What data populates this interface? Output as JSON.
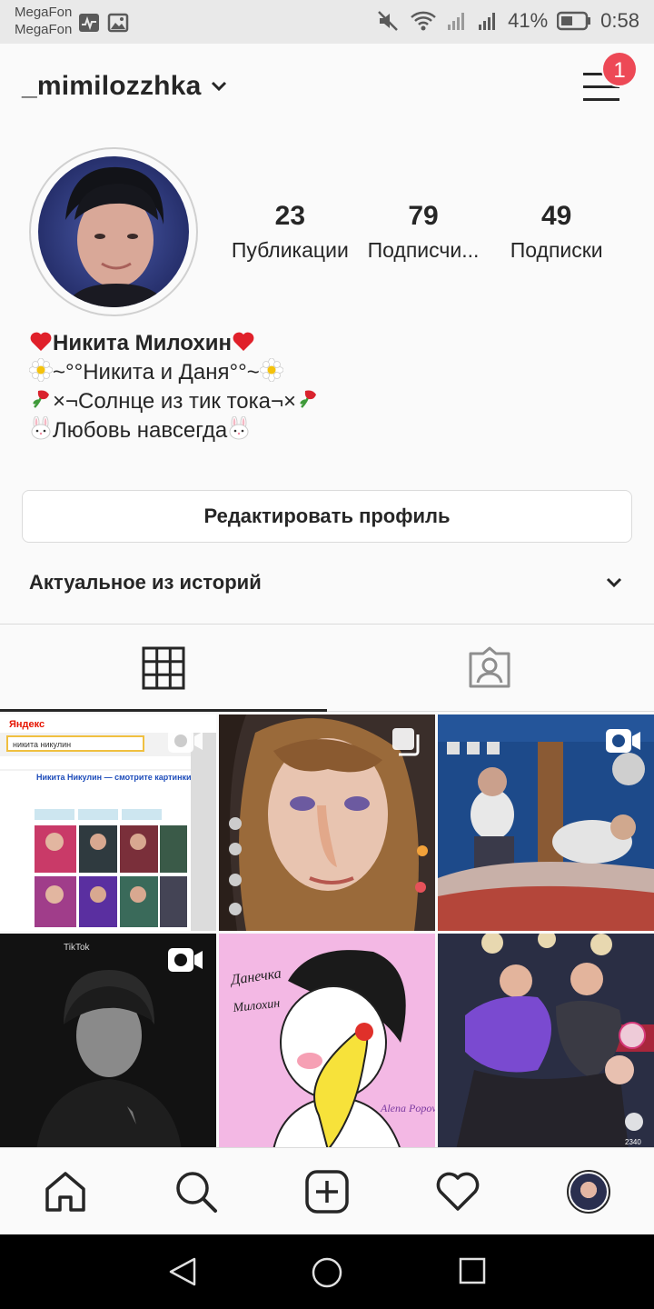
{
  "status_bar": {
    "carrier_1": "MegaFon",
    "carrier_2": "MegaFon",
    "battery": "41%",
    "time": "0:58"
  },
  "header": {
    "username": "_mimilozzhka",
    "notification_count": "1"
  },
  "profile": {
    "stats": [
      {
        "value": "23",
        "label": "Публикации"
      },
      {
        "value": "79",
        "label": "Подписчи..."
      },
      {
        "value": "49",
        "label": "Подписки"
      }
    ],
    "bio": {
      "line1": "Никита Милохин",
      "line2": "~°°Никита и Даня°°~",
      "line3": "×¬Солнце из тик тока¬×",
      "line4": "Любовь навсегда"
    },
    "edit_button": "Редактировать профиль",
    "highlights_label": "Актуальное из историй"
  },
  "grid": {
    "posts": [
      {
        "type": "video",
        "title": "Яндекс search screenshot"
      },
      {
        "type": "multiple"
      },
      {
        "type": "video"
      },
      {
        "type": "video"
      },
      {
        "type": "photo"
      },
      {
        "type": "photo"
      }
    ],
    "post1_logo": "Яндекс",
    "post1_search": "никита никулин",
    "post1_result": "Никита Никулин — смотрите картинки",
    "post4_brand": "TikTok",
    "post5_text_1": "Данечка",
    "post5_text_2": "Милохин",
    "post5_signature": "Alena Popova",
    "post6_count": "2340"
  },
  "colors": {
    "accent_badge": "#ed4956",
    "text": "#262626",
    "background": "#fafafa"
  },
  "icons": {
    "nav": [
      "home-icon",
      "search-icon",
      "add-post-icon",
      "heart-icon",
      "profile-avatar"
    ],
    "tabs": [
      "grid-icon",
      "tagged-icon"
    ]
  }
}
